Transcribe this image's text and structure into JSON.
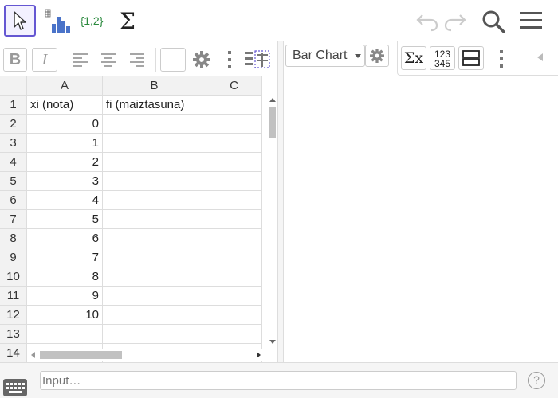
{
  "toolbar": {
    "tools": [
      {
        "name": "move-tool",
        "icon": "pointer-arrow-icon"
      },
      {
        "name": "one-variable-analysis-tool",
        "icon": "bar-histogram-icon"
      },
      {
        "name": "create-list-tool",
        "label": "{1,2}"
      },
      {
        "name": "sum-tool",
        "label": "Σ"
      }
    ],
    "accent": "#6557d2"
  },
  "spreadsheet_toolbar": {
    "bold": "B",
    "italic": "I"
  },
  "spreadsheet": {
    "columns": [
      "A",
      "B",
      "C"
    ],
    "rows": [
      {
        "num": "1",
        "a": "xi (nota)",
        "b": "fi (maiztasuna)",
        "c": ""
      },
      {
        "num": "2",
        "a": "0",
        "b": "",
        "c": ""
      },
      {
        "num": "3",
        "a": "1",
        "b": "",
        "c": ""
      },
      {
        "num": "4",
        "a": "2",
        "b": "",
        "c": ""
      },
      {
        "num": "5",
        "a": "3",
        "b": "",
        "c": ""
      },
      {
        "num": "6",
        "a": "4",
        "b": "",
        "c": ""
      },
      {
        "num": "7",
        "a": "5",
        "b": "",
        "c": ""
      },
      {
        "num": "8",
        "a": "6",
        "b": "",
        "c": ""
      },
      {
        "num": "9",
        "a": "7",
        "b": "",
        "c": ""
      },
      {
        "num": "10",
        "a": "8",
        "b": "",
        "c": ""
      },
      {
        "num": "11",
        "a": "9",
        "b": "",
        "c": ""
      },
      {
        "num": "12",
        "a": "10",
        "b": "",
        "c": ""
      },
      {
        "num": "13",
        "a": "",
        "b": "",
        "c": ""
      },
      {
        "num": "14",
        "a": "",
        "b": "",
        "c": ""
      }
    ]
  },
  "graphics_panel": {
    "chart_type": "Bar Chart",
    "stats_label": "Σx",
    "data_label_top": "123",
    "data_label_bottom": "345"
  },
  "input_bar": {
    "placeholder": "Input…"
  }
}
